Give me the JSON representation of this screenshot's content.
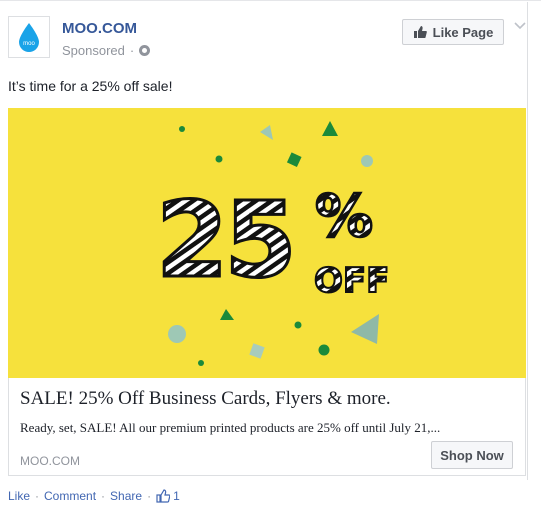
{
  "post": {
    "page_name": "MOO.COM",
    "sponsored_label": "Sponsored",
    "separator": "·",
    "like_page_label": "Like Page",
    "message": "It’s time for a 25% off sale!",
    "avatar_text": "moo",
    "brand_color": "#1aa3e8"
  },
  "ad_image": {
    "headline_number": "25",
    "percent_sign": "%",
    "off_text": "OFF",
    "background_color": "#f6e13c"
  },
  "link": {
    "title": "SALE! 25% Off Business Cards, Flyers & more.",
    "description": "Ready, set, SALE! All our premium printed products are 25% off until July 21,...",
    "domain": "MOO.COM",
    "cta_label": "Shop Now"
  },
  "actions": {
    "like": "Like",
    "comment": "Comment",
    "share": "Share",
    "separator": "·",
    "like_count": "1"
  }
}
